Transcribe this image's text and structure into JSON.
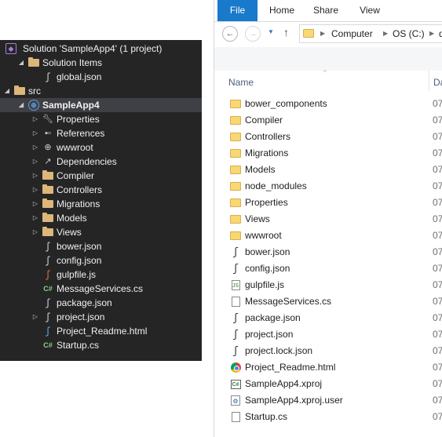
{
  "solution_explorer": {
    "items": [
      {
        "label": "Solution 'SampleApp4' (1 project)",
        "icon": "vs-solution-icon",
        "twisty": ""
      },
      {
        "label": "Solution Items",
        "icon": "folder-icon",
        "twisty": "◢"
      },
      {
        "label": "global.json",
        "icon": "json-file-icon",
        "twisty": ""
      },
      {
        "label": "src",
        "icon": "folder-icon",
        "twisty": "◢"
      },
      {
        "label": "SampleApp4",
        "icon": "web-project-icon",
        "twisty": "◢"
      },
      {
        "label": "Properties",
        "icon": "wrench-icon",
        "twisty": "▷"
      },
      {
        "label": "References",
        "icon": "references-icon",
        "twisty": "▷"
      },
      {
        "label": "wwwroot",
        "icon": "globe-icon",
        "twisty": "▷"
      },
      {
        "label": "Dependencies",
        "icon": "dependencies-icon",
        "twisty": "▷"
      },
      {
        "label": "Compiler",
        "icon": "folder-icon",
        "twisty": "▷"
      },
      {
        "label": "Controllers",
        "icon": "folder-icon",
        "twisty": "▷"
      },
      {
        "label": "Migrations",
        "icon": "folder-icon",
        "twisty": "▷"
      },
      {
        "label": "Models",
        "icon": "folder-icon",
        "twisty": "▷"
      },
      {
        "label": "Views",
        "icon": "folder-icon",
        "twisty": "▷"
      },
      {
        "label": "bower.json",
        "icon": "json-file-icon",
        "twisty": ""
      },
      {
        "label": "config.json",
        "icon": "json-file-icon",
        "twisty": ""
      },
      {
        "label": "gulpfile.js",
        "icon": "js-file-icon",
        "twisty": ""
      },
      {
        "label": "MessageServices.cs",
        "icon": "csharp-file-icon",
        "twisty": ""
      },
      {
        "label": "package.json",
        "icon": "json-file-icon",
        "twisty": ""
      },
      {
        "label": "project.json",
        "icon": "json-file-icon",
        "twisty": "▷"
      },
      {
        "label": "Project_Readme.html",
        "icon": "html-file-icon",
        "twisty": ""
      },
      {
        "label": "Startup.cs",
        "icon": "csharp-file-icon",
        "twisty": ""
      }
    ],
    "selected_index": 4
  },
  "explorer": {
    "tabs": [
      "File",
      "Home",
      "Share",
      "View"
    ],
    "address": {
      "crumbs": [
        "Computer",
        "OS (C:)",
        "d"
      ]
    },
    "columns": {
      "name": "Name",
      "date": "Da"
    },
    "files": [
      {
        "name": "bower_components",
        "icon": "folder-icon",
        "date": "07"
      },
      {
        "name": "Compiler",
        "icon": "folder-icon",
        "date": "07"
      },
      {
        "name": "Controllers",
        "icon": "folder-icon",
        "date": "07"
      },
      {
        "name": "Migrations",
        "icon": "folder-icon",
        "date": "07"
      },
      {
        "name": "Models",
        "icon": "folder-icon",
        "date": "07"
      },
      {
        "name": "node_modules",
        "icon": "folder-icon",
        "date": "07"
      },
      {
        "name": "Properties",
        "icon": "folder-icon",
        "date": "07"
      },
      {
        "name": "Views",
        "icon": "folder-icon",
        "date": "07"
      },
      {
        "name": "wwwroot",
        "icon": "folder-icon",
        "date": "07"
      },
      {
        "name": "bower.json",
        "icon": "json-file-icon",
        "date": "07"
      },
      {
        "name": "config.json",
        "icon": "json-file-icon",
        "date": "07"
      },
      {
        "name": "gulpfile.js",
        "icon": "js-file-icon",
        "date": "07"
      },
      {
        "name": "MessageServices.cs",
        "icon": "document-icon",
        "date": "07"
      },
      {
        "name": "package.json",
        "icon": "json-file-icon",
        "date": "07"
      },
      {
        "name": "project.json",
        "icon": "json-file-icon",
        "date": "07"
      },
      {
        "name": "project.lock.json",
        "icon": "json-file-icon",
        "date": "07"
      },
      {
        "name": "Project_Readme.html",
        "icon": "chrome-icon",
        "date": "07"
      },
      {
        "name": "SampleApp4.xproj",
        "icon": "csharp-project-icon",
        "date": "07"
      },
      {
        "name": "SampleApp4.xproj.user",
        "icon": "user-file-icon",
        "date": "07"
      },
      {
        "name": "Startup.cs",
        "icon": "document-icon",
        "date": "07"
      }
    ]
  },
  "colors": {
    "explorer_dark_bg": "#252526",
    "selected_row": "#3f3f46",
    "file_tab": "#1979ca",
    "folder": "#f8d775"
  }
}
